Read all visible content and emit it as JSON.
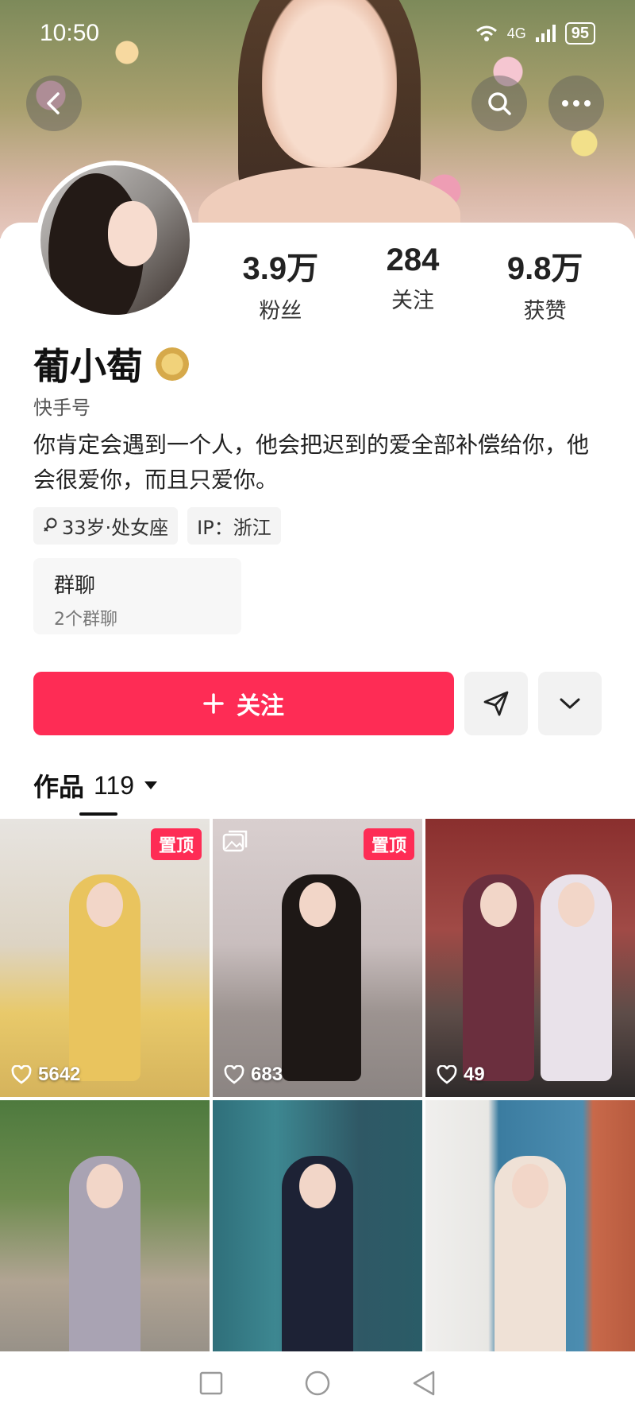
{
  "status_bar": {
    "time": "10:50",
    "network": "4G",
    "battery": "95"
  },
  "profile": {
    "name": "葡小萄",
    "kuaishou_label": "快手号",
    "bio": "你肯定会遇到一个人，他会把迟到的爱全部补偿给你，他会很爱你，而且只爱你。",
    "tags": [
      "33岁·处女座",
      "IP：浙江"
    ],
    "stats": [
      {
        "value": "3.9万",
        "label": "粉丝"
      },
      {
        "value": "284",
        "label": "关注"
      },
      {
        "value": "9.8万",
        "label": "获赞"
      }
    ],
    "group": {
      "title": "群聊",
      "subtitle": "2个群聊"
    }
  },
  "actions": {
    "follow_label": "关注"
  },
  "works": {
    "tab_label": "作品",
    "count": "119",
    "items": [
      {
        "likes": "5642",
        "pinned": true
      },
      {
        "likes": "683",
        "pinned": true
      },
      {
        "likes": "49",
        "pinned": false
      },
      {
        "likes": "",
        "pinned": false
      },
      {
        "likes": "",
        "pinned": false
      },
      {
        "likes": "",
        "pinned": false
      }
    ],
    "pinned_label": "置顶"
  },
  "colors": {
    "accent": "#fe2c55"
  },
  "icons": [
    "back-icon",
    "search-icon",
    "more-icon",
    "send-icon",
    "chevron-down-icon",
    "heart-icon",
    "gallery-icon",
    "square-icon",
    "circle-icon",
    "triangle-back-icon"
  ]
}
